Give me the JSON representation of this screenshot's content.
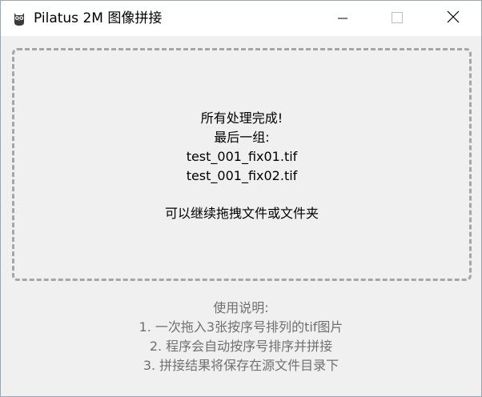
{
  "window": {
    "title": "Pilatus 2M 图像拼接",
    "app_icon": "owl-icon",
    "controls": {
      "minimize_icon": "minimize-icon",
      "maximize_icon": "maximize-icon",
      "close_icon": "close-icon"
    }
  },
  "dropzone": {
    "status_lines": [
      "所有处理完成!",
      "最后一组:",
      "test_001_fix01.tif",
      "test_001_fix02.tif"
    ],
    "hint": "可以继续拖拽文件或文件夹"
  },
  "instructions": {
    "heading": "使用说明:",
    "steps": [
      "1. 一次拖入3张按序号排列的tif图片",
      "2. 程序会自动按序号排序并拼接",
      "3. 拼接结果将保存在源文件目录下"
    ]
  },
  "colors": {
    "titlebar_bg": "#ffffff",
    "window_bg": "#f0f0f0",
    "dashed_border": "#a6a6a6",
    "instruction_text": "#707070"
  }
}
